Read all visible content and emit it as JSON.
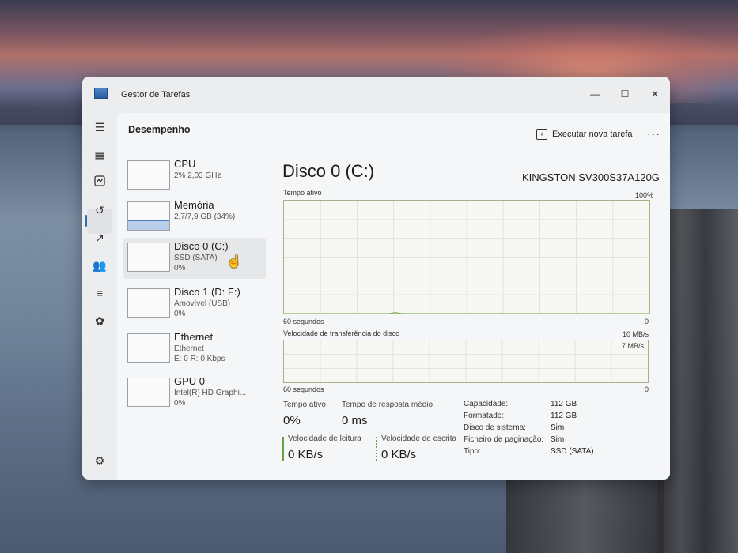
{
  "window": {
    "title": "Gestor de Tarefas"
  },
  "header": {
    "section": "Desempenho",
    "run_task_label": "Executar nova tarefa"
  },
  "devices": [
    {
      "name": "CPU",
      "sub1": "2% 2,03 GHz",
      "sub2": ""
    },
    {
      "name": "Memória",
      "sub1": "2,7/7,9 GB (34%)",
      "sub2": ""
    },
    {
      "name": "Disco 0 (C:)",
      "sub1": "SSD (SATA)",
      "sub2": "0%"
    },
    {
      "name": "Disco 1 (D: F:)",
      "sub1": "Amovível (USB)",
      "sub2": "0%"
    },
    {
      "name": "Ethernet",
      "sub1": "Ethernet",
      "sub2": "E: 0 R: 0 Kbps"
    },
    {
      "name": "GPU 0",
      "sub1": "Intel(R) HD Graphi...",
      "sub2": "0%"
    }
  ],
  "main": {
    "title": "Disco 0 (C:)",
    "model": "KINGSTON SV300S37A120G",
    "active_chart": {
      "label": "Tempo ativo",
      "max": "100%",
      "xlabel": "60 segundos",
      "min": "0"
    },
    "transfer_chart": {
      "label": "Velocidade de transferência do disco",
      "max": "10 MB/s",
      "mid": "7 MB/s",
      "xlabel": "60 segundos",
      "min": "0"
    },
    "stats": {
      "active_label": "Tempo ativo",
      "active_value": "0%",
      "response_label": "Tempo de resposta médio",
      "response_value": "0 ms",
      "read_label": "Velocidade de leitura",
      "read_value": "0 KB/s",
      "write_label": "Velocidade de escrita",
      "write_value": "0 KB/s"
    },
    "properties": [
      {
        "key": "Capacidade:",
        "value": "112 GB"
      },
      {
        "key": "Formatado:",
        "value": "112 GB"
      },
      {
        "key": "Disco de sistema:",
        "value": "Sim"
      },
      {
        "key": "Ficheiro de paginação:",
        "value": "Sim"
      },
      {
        "key": "Tipo:",
        "value": "SSD (SATA)"
      }
    ]
  },
  "chart_data": [
    {
      "type": "area",
      "ylabel": "Tempo ativo",
      "xlabel": "60 segundos",
      "ylim": [
        0,
        100
      ],
      "series": [
        {
          "values": [
            0,
            0,
            0,
            0,
            0,
            0,
            0,
            0,
            0,
            0,
            0,
            0,
            0,
            0,
            0,
            0,
            0,
            0,
            1,
            0,
            0,
            0,
            0,
            0,
            0,
            0,
            0,
            0,
            0,
            0,
            0,
            0,
            0,
            0,
            0,
            0,
            0,
            0,
            0,
            0,
            0,
            0,
            0,
            0,
            0,
            0,
            0,
            0,
            0,
            0,
            0,
            0,
            0,
            0,
            0,
            0,
            0,
            0,
            0,
            0
          ]
        }
      ]
    },
    {
      "type": "area",
      "ylabel": "Velocidade de transferência do disco",
      "xlabel": "60 segundos",
      "ylim": [
        0,
        10
      ],
      "series": [
        {
          "values": [
            0,
            0,
            0,
            0,
            0,
            0,
            0,
            0,
            0,
            0,
            0,
            0,
            0,
            0,
            0,
            0,
            0,
            0,
            0,
            0,
            0,
            0,
            0,
            0,
            0,
            0,
            0,
            0,
            0,
            0,
            0,
            0,
            0,
            0,
            0,
            0,
            0,
            0,
            0,
            0,
            0,
            0,
            0,
            0,
            0,
            0,
            0,
            0,
            0,
            0,
            0,
            0,
            0,
            0,
            0,
            0,
            0,
            0,
            0,
            0
          ]
        }
      ]
    }
  ],
  "colors": {
    "accent": "#2d6fb8",
    "disk_line": "#6ea141",
    "disk_fill": "#cfe3b0"
  }
}
